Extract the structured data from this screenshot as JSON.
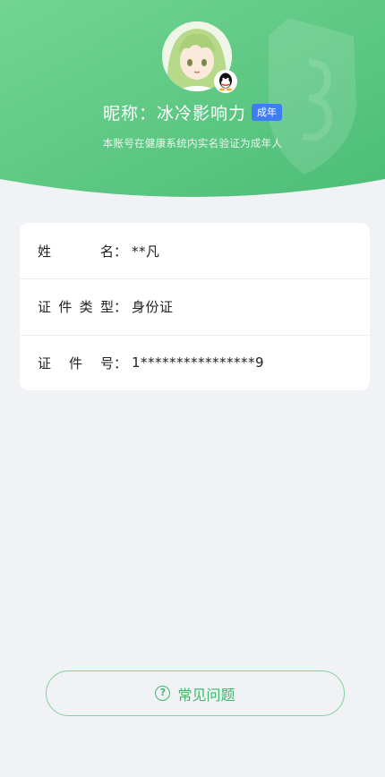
{
  "header": {
    "nickname": "昵称：冰冷影响力",
    "age_badge": "成年",
    "verification_note": "本账号在健康系统内实名验证为成年人"
  },
  "colors": {
    "header_green_light": "#6fd38e",
    "header_green_dark": "#4fc07a",
    "age_badge_blue": "#3f7ef2",
    "faq_green": "#3fb86a",
    "page_bg": "#f0f2f5"
  },
  "info_card": {
    "rows": [
      {
        "label": "姓名：",
        "label_chars": [
          "姓",
          "名："
        ],
        "value": "**凡"
      },
      {
        "label": "证件类型：",
        "label_chars": [
          "证",
          "件",
          "类",
          "型："
        ],
        "value": "身份证"
      },
      {
        "label": "证件号：",
        "label_chars": [
          "证",
          "件",
          "号："
        ],
        "value": "1****************9"
      }
    ]
  },
  "faq": {
    "icon": "question-circle-icon",
    "icon_glyph": "?",
    "label": "常见问题"
  }
}
